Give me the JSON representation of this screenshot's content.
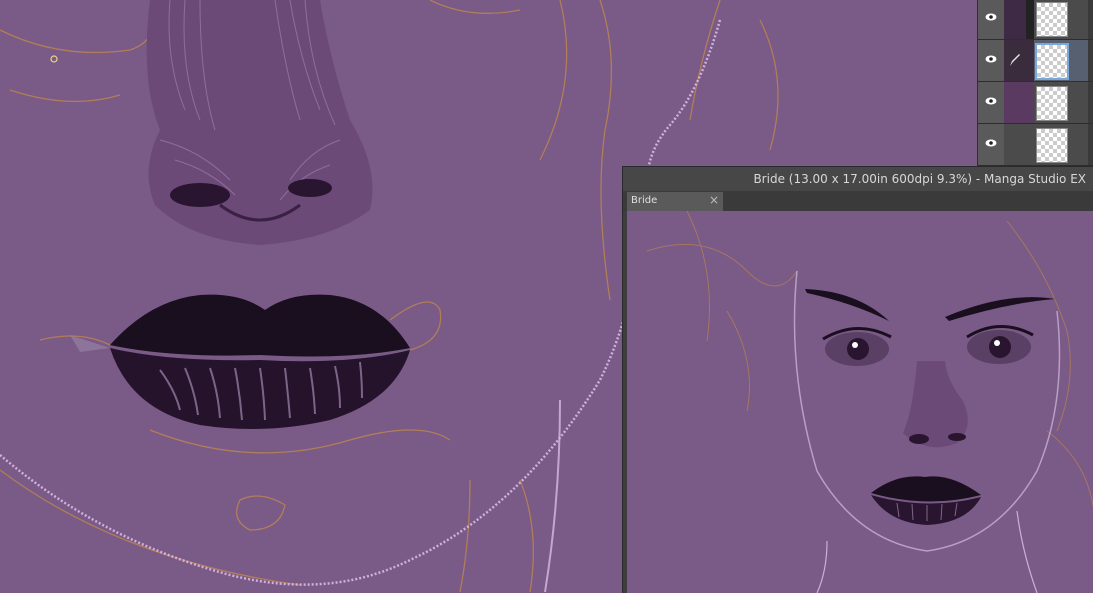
{
  "navigator": {
    "window_title": "Bride (13.00 x 17.00in 600dpi 9.3%)  - Manga Studio EX",
    "tab_label": "Bride",
    "tab_close": "×"
  },
  "colors": {
    "canvas": "#7a5a86",
    "lips": "#1a0f1e",
    "sketch_orange": "#c48a4a",
    "highlight": "#d9b8e6",
    "panel_bg": "#4b4b4b"
  },
  "layers_panel": {
    "rows": [
      {
        "visible": true,
        "selected": false,
        "swatch": "#3e2a44"
      },
      {
        "visible": true,
        "selected": true,
        "swatch": "#3b2c3d"
      },
      {
        "visible": true,
        "selected": false,
        "swatch": "#5a3a60"
      },
      {
        "visible": true,
        "selected": false,
        "swatch": "#4b4b4b"
      }
    ]
  }
}
